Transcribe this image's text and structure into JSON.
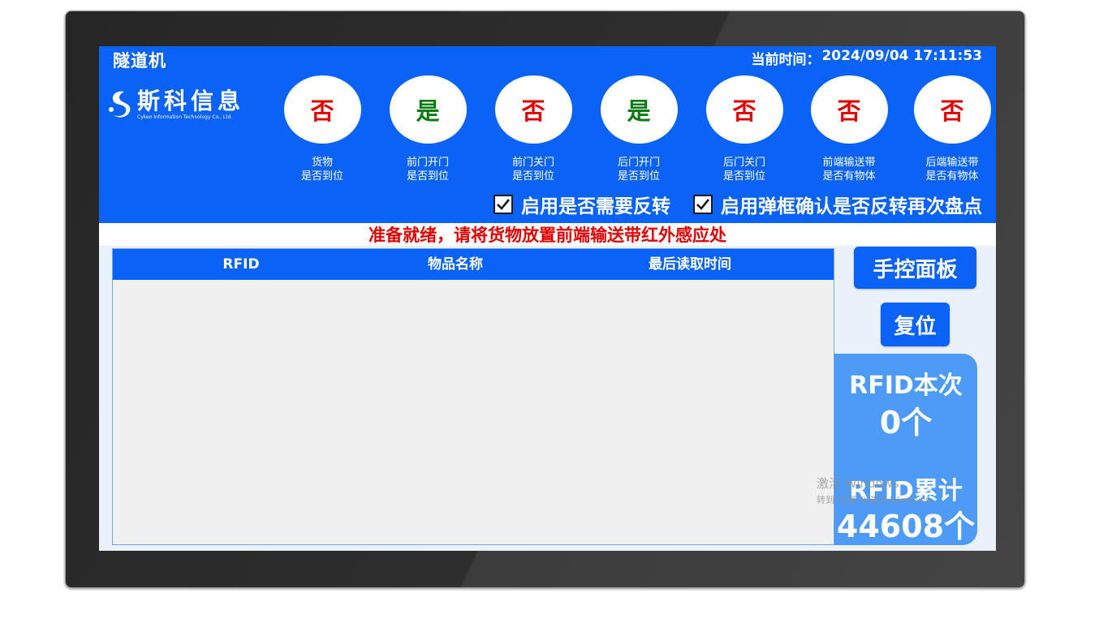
{
  "app": {
    "title": "隧道机"
  },
  "clock": {
    "label": "当前时间：",
    "value": "2024/09/04 17:11:53"
  },
  "logo": {
    "name": "斯科信息",
    "subtitle": "Cykeo Information Technology Co., Ltd."
  },
  "indicators": [
    {
      "value": "否",
      "line1": "货物",
      "line2": "是否到位",
      "color": "#e00000"
    },
    {
      "value": "是",
      "line1": "前门开门",
      "line2": "是否到位",
      "color": "#0a7d12"
    },
    {
      "value": "否",
      "line1": "前门关门",
      "line2": "是否到位",
      "color": "#e00000"
    },
    {
      "value": "是",
      "line1": "后门开门",
      "line2": "是否到位",
      "color": "#0a7d12"
    },
    {
      "value": "否",
      "line1": "后门关门",
      "line2": "是否到位",
      "color": "#e00000"
    },
    {
      "value": "否",
      "line1": "前端输送带",
      "line2": "是否有物体",
      "color": "#e00000"
    },
    {
      "value": "否",
      "line1": "后端输送带",
      "line2": "是否有物体",
      "color": "#e00000"
    }
  ],
  "options": {
    "reverse": {
      "label": "启用是否需要反转",
      "checked": true
    },
    "confirm_reverse": {
      "label": "启用弹框确认是否反转再次盘点",
      "checked": true
    }
  },
  "status_message": "准备就绪，请将货物放置前端输送带红外感应处",
  "table": {
    "columns": [
      "RFID",
      "物品名称",
      "最后读取时间"
    ],
    "rows": []
  },
  "buttons": {
    "manual_panel": "手控面板",
    "reset": "复位"
  },
  "stats": {
    "current_label": "RFID本次",
    "current_value": "0个",
    "total_label": "RFID累计",
    "total_value": "44608个"
  },
  "watermark": {
    "line1": "激活 Windows",
    "line2": "转到\"设置\"以激活 Windows。"
  },
  "colors": {
    "accent": "#0a63f6",
    "yes": "#0a7d12",
    "no": "#e00000",
    "stats_panel": "#4d9af7"
  }
}
